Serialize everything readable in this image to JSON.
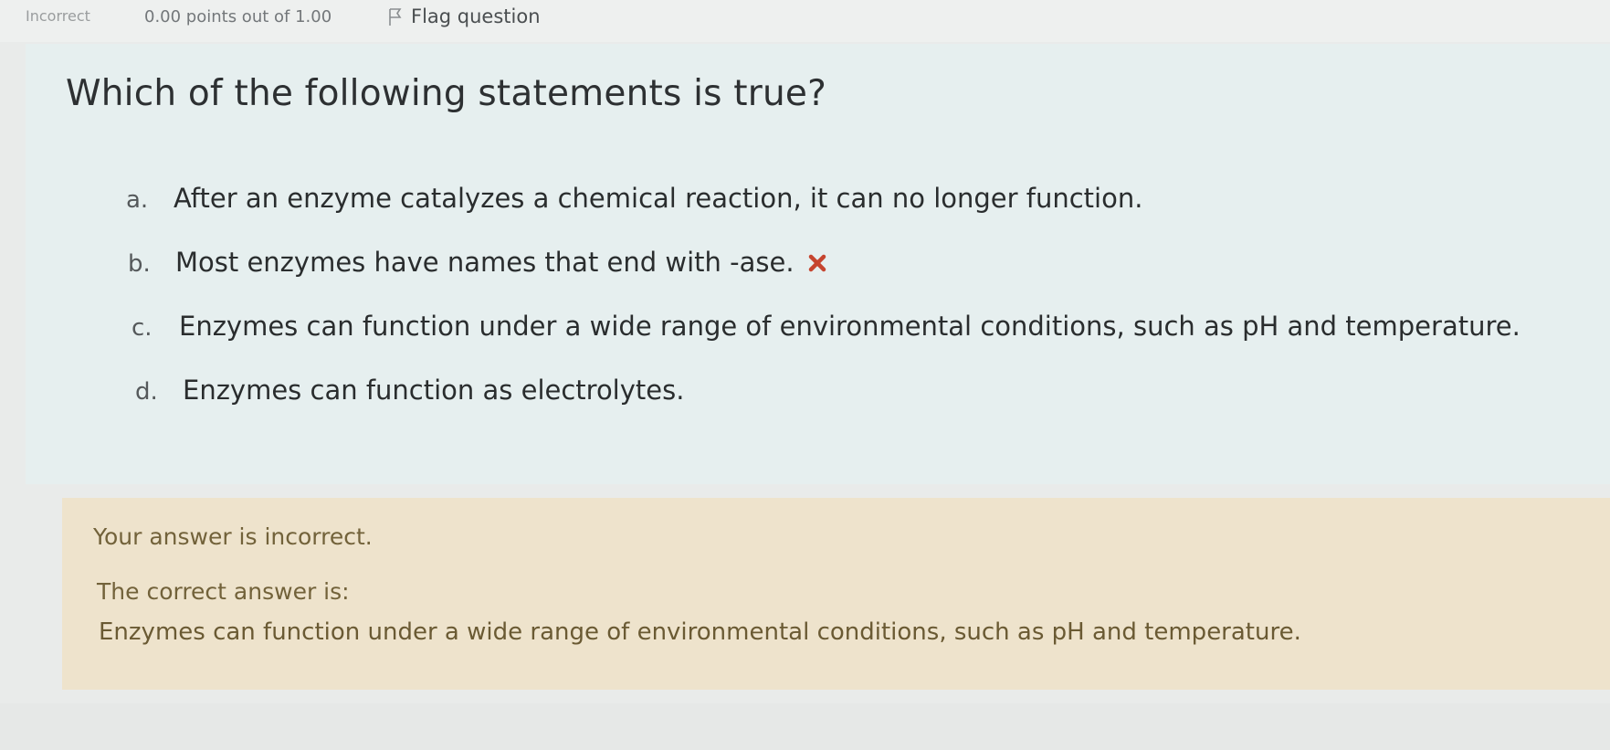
{
  "info": {
    "status": "Incorrect",
    "grade": "0.00 points out of 1.00",
    "flag_label": "Flag question"
  },
  "question": {
    "text": "Which of the following statements is true?",
    "answers": [
      {
        "letter": "a.",
        "text": "After an enzyme catalyzes a chemical reaction, it can no longer function."
      },
      {
        "letter": "b.",
        "text": "Most enzymes have names that end with -ase."
      },
      {
        "letter": "c.",
        "text": "Enzymes can function under a wide range of environmental conditions, such as pH and temperature."
      },
      {
        "letter": "d.",
        "text": "Enzymes can function as electrolytes."
      }
    ]
  },
  "feedback": {
    "result": "Your answer is incorrect.",
    "correct_label": "The correct answer is:",
    "correct_answer": "Enzymes can function under a wide range of environmental conditions, such as pH and temperature."
  },
  "colors": {
    "question_bg": "#e6efef",
    "feedback_bg": "#eee3cc",
    "incorrect_mark": "#c6452f"
  },
  "icons": {
    "flag": "flag-icon",
    "incorrect_mark": "cross-icon"
  }
}
